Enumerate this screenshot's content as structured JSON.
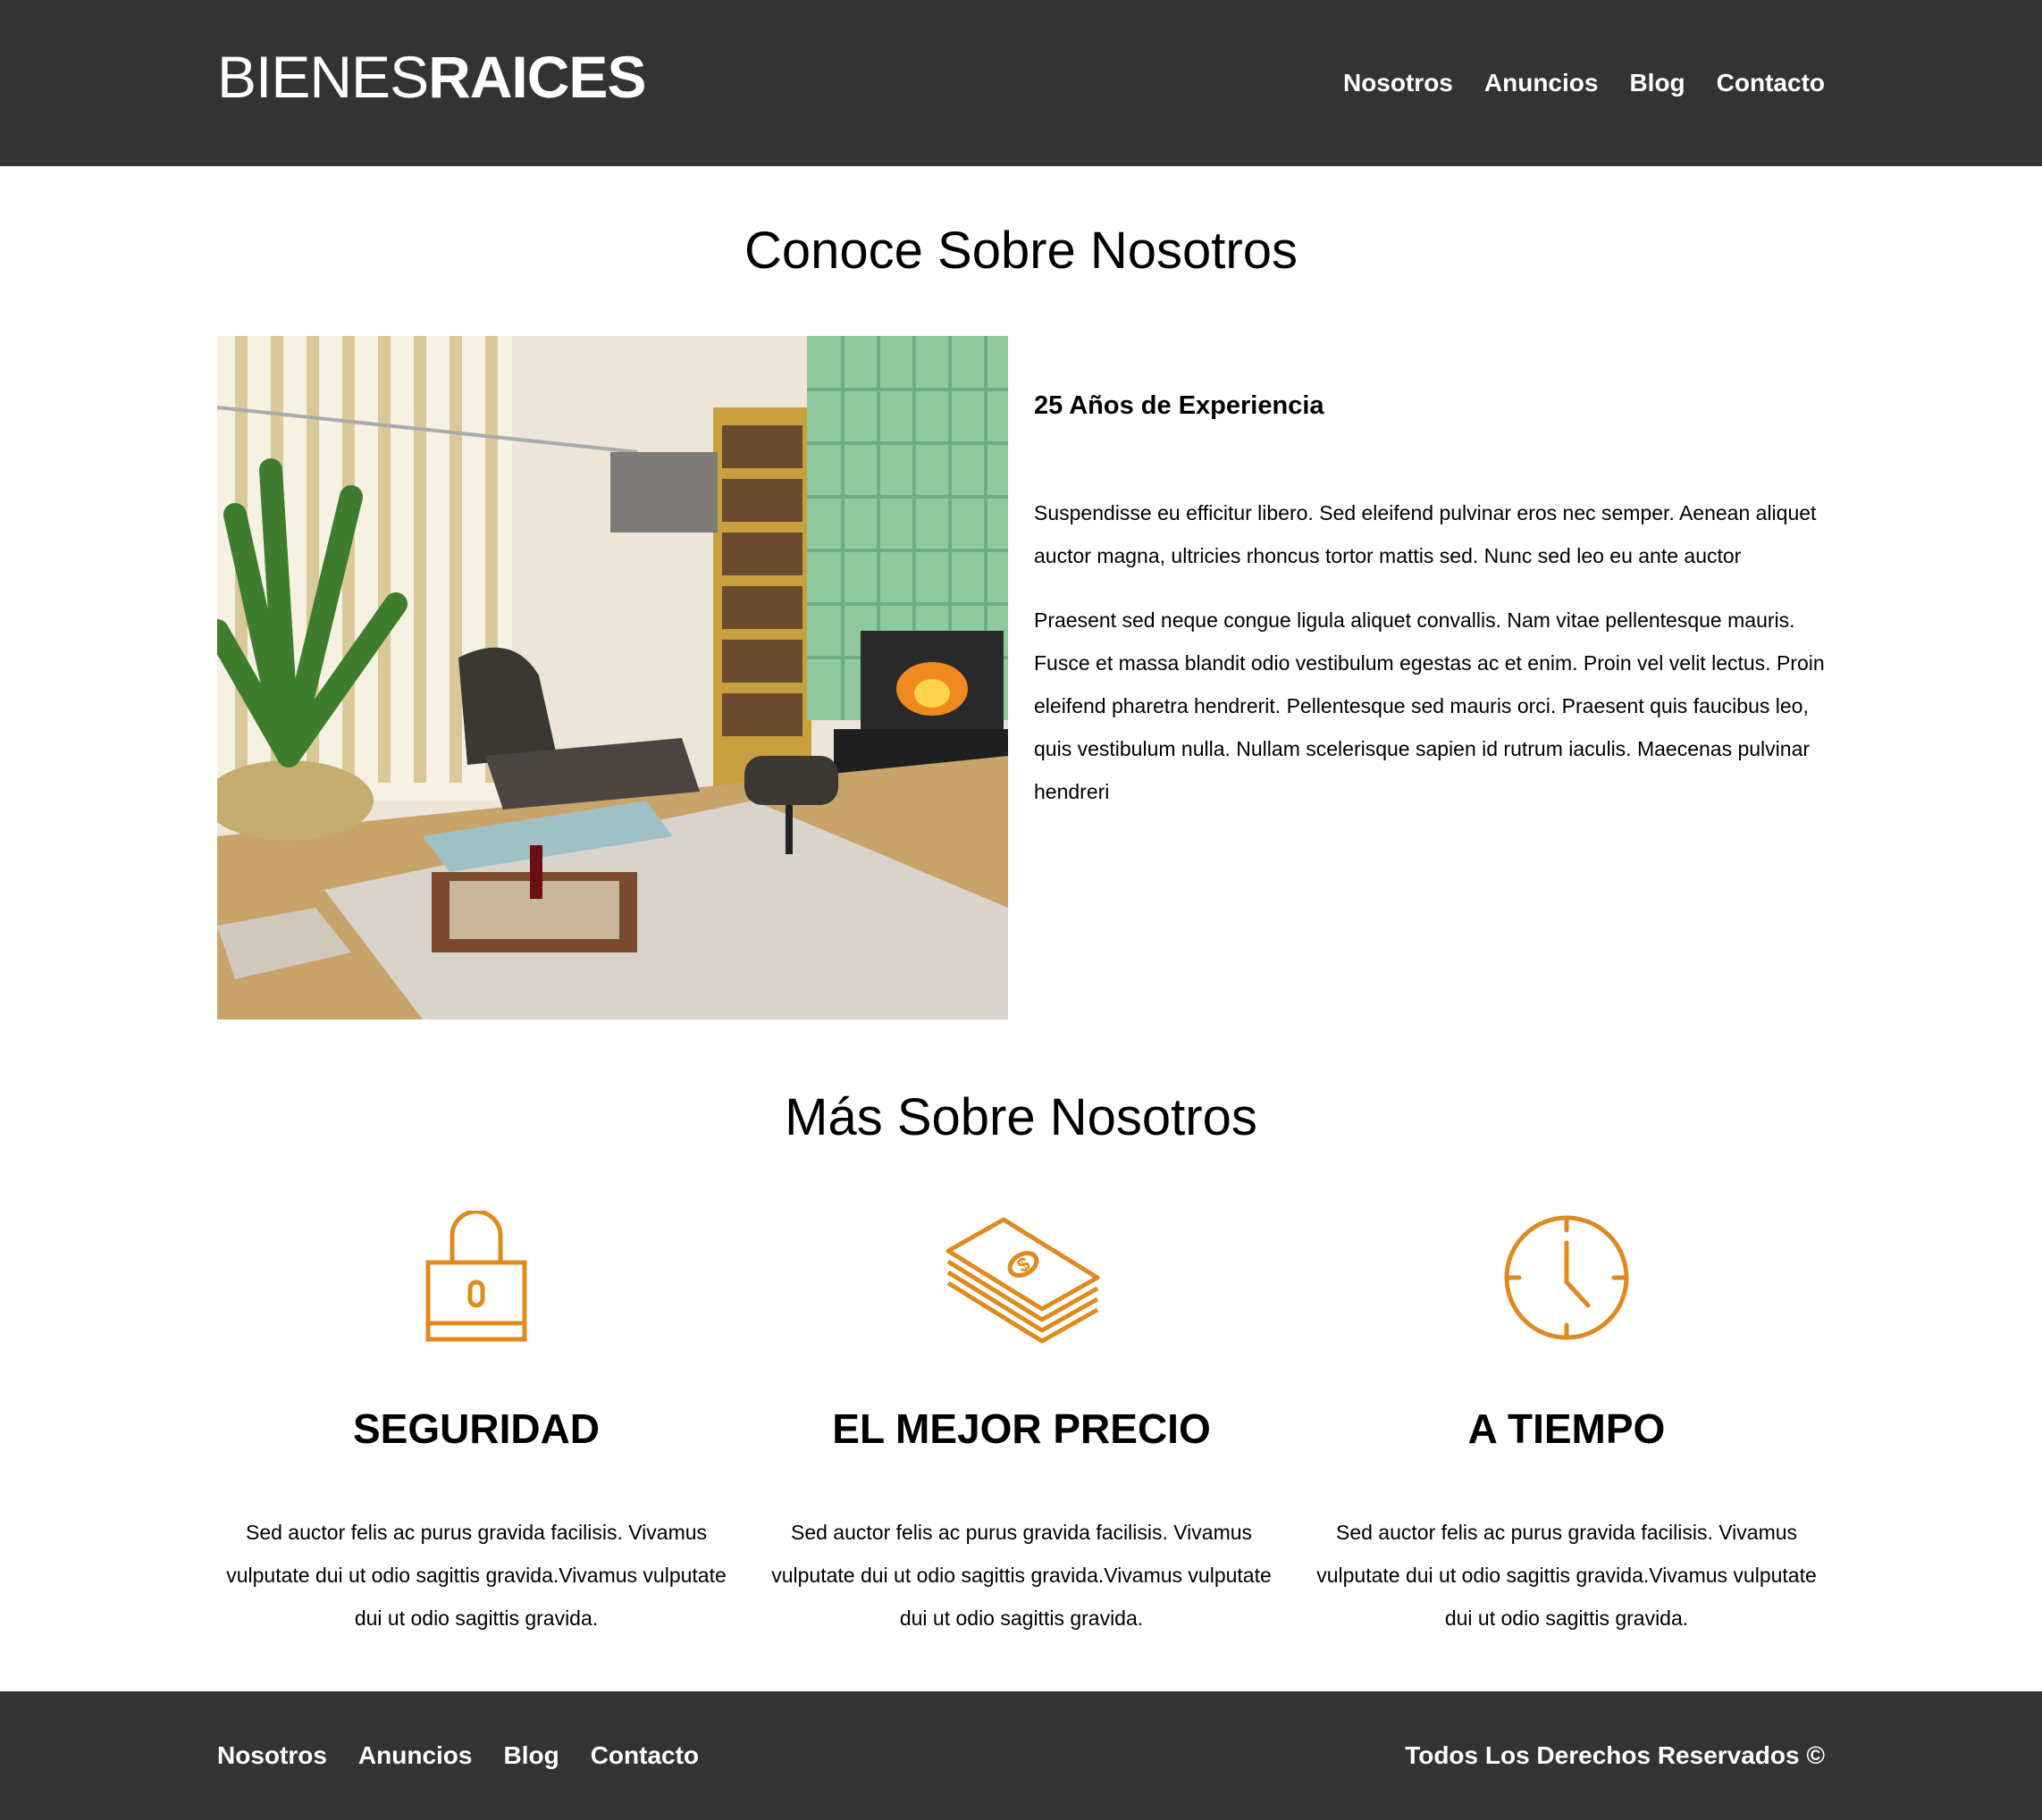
{
  "header": {
    "logo_light": "BIENES",
    "logo_bold": "RAICES",
    "nav": [
      "Nosotros",
      "Anuncios",
      "Blog",
      "Contacto"
    ]
  },
  "about": {
    "title": "Conoce Sobre Nosotros",
    "subtitle": "25 Años de Experiencia",
    "paragraphs": [
      "Suspendisse eu efficitur libero. Sed eleifend pulvinar eros nec semper. Aenean aliquet auctor magna, ultricies rhoncus tortor mattis sed. Nunc sed leo eu ante auctor",
      "Praesent sed neque congue ligula aliquet convallis. Nam vitae pellentesque mauris. Fusce et massa blandit odio vestibulum egestas ac et enim. Proin vel velit lectus. Proin eleifend pharetra hendrerit. Pellentesque sed mauris orci. Praesent quis faucibus leo, quis vestibulum nulla. Nullam scelerisque sapien id rutrum iaculis. Maecenas pulvinar hendreri"
    ]
  },
  "more": {
    "title": "Más Sobre Nosotros",
    "features": [
      {
        "icon": "lock-icon",
        "title": "SEGURIDAD",
        "text": "Sed auctor felis ac purus gravida facilisis. Vivamus vulputate dui ut odio sagittis gravida.Vivamus vulputate dui ut odio sagittis gravida."
      },
      {
        "icon": "money-icon",
        "title": "EL MEJOR PRECIO",
        "text": "Sed auctor felis ac purus gravida facilisis. Vivamus vulputate dui ut odio sagittis gravida.Vivamus vulputate dui ut odio sagittis gravida."
      },
      {
        "icon": "clock-icon",
        "title": "A TIEMPO",
        "text": "Sed auctor felis ac purus gravida facilisis. Vivamus vulputate dui ut odio sagittis gravida.Vivamus vulputate dui ut odio sagittis gravida."
      }
    ]
  },
  "footer": {
    "nav": [
      "Nosotros",
      "Anuncios",
      "Blog",
      "Contacto"
    ],
    "copyright": "Todos Los Derechos Reservados ©"
  },
  "colors": {
    "dark": "#333333",
    "accent": "#e08a1e",
    "text": "#000000"
  }
}
